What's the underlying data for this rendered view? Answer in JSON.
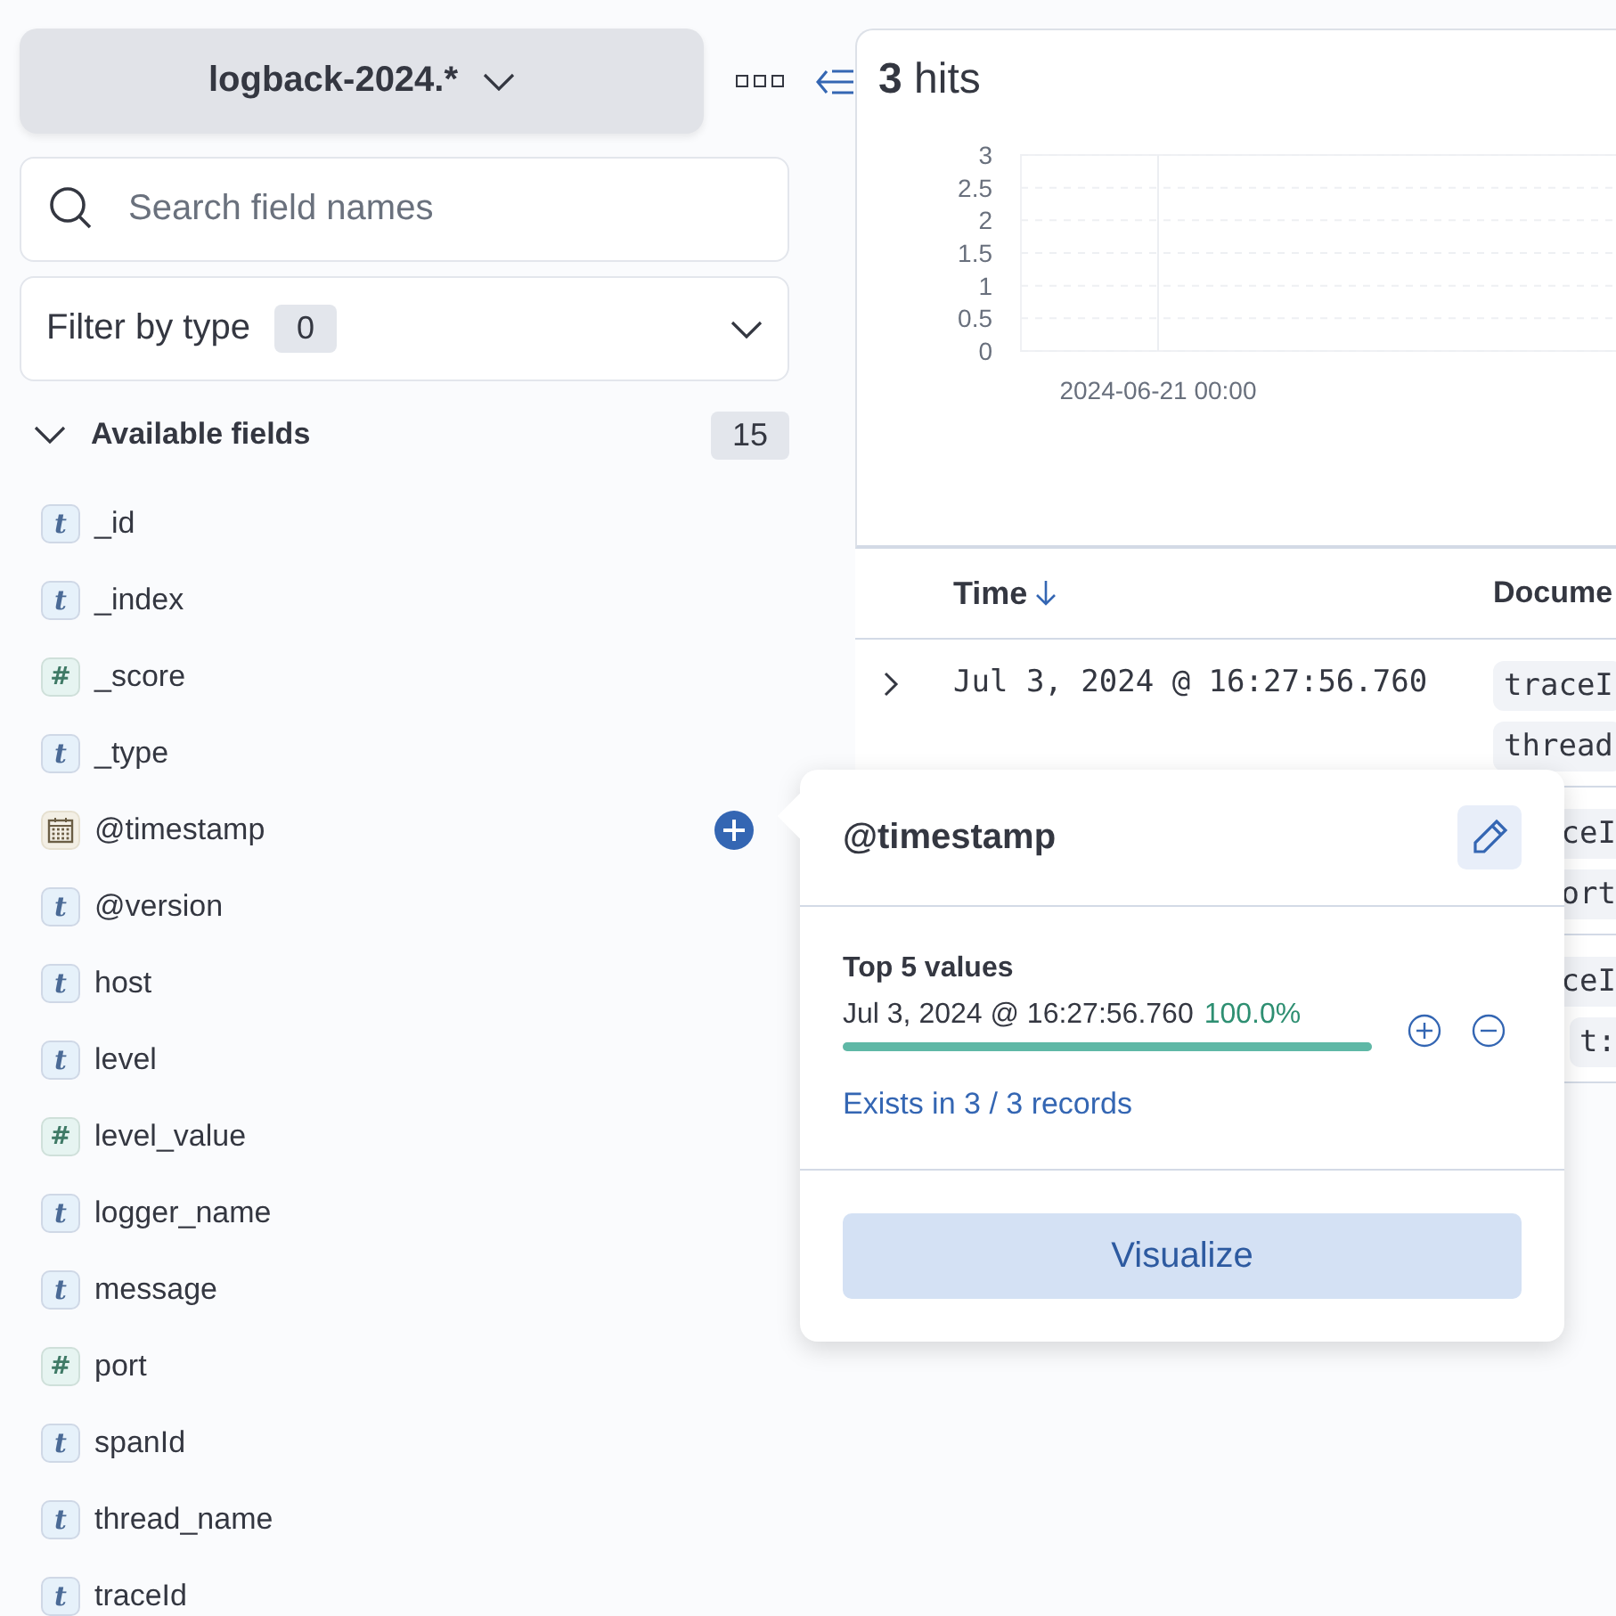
{
  "data_view": {
    "label": "logback-2024.*"
  },
  "search": {
    "placeholder": "Search field names"
  },
  "filter": {
    "label": "Filter by type",
    "count": "0"
  },
  "available_fields": {
    "label": "Available fields",
    "count": "15",
    "expanded": true,
    "items": [
      {
        "name": "_id",
        "kind": "text",
        "type_icon": "t",
        "selected": false
      },
      {
        "name": "_index",
        "kind": "text",
        "type_icon": "t",
        "selected": false
      },
      {
        "name": "_score",
        "kind": "number",
        "type_icon": "#",
        "selected": false
      },
      {
        "name": "_type",
        "kind": "text",
        "type_icon": "t",
        "selected": false
      },
      {
        "name": "@timestamp",
        "kind": "date",
        "selected": true
      },
      {
        "name": "@version",
        "kind": "text",
        "type_icon": "t",
        "selected": false
      },
      {
        "name": "host",
        "kind": "text",
        "type_icon": "t",
        "selected": false
      },
      {
        "name": "level",
        "kind": "text",
        "type_icon": "t",
        "selected": false
      },
      {
        "name": "level_value",
        "kind": "number",
        "type_icon": "#",
        "selected": false
      },
      {
        "name": "logger_name",
        "kind": "text",
        "type_icon": "t",
        "selected": false
      },
      {
        "name": "message",
        "kind": "text",
        "type_icon": "t",
        "selected": false
      },
      {
        "name": "port",
        "kind": "number",
        "type_icon": "#",
        "selected": false
      },
      {
        "name": "spanId",
        "kind": "text",
        "type_icon": "t",
        "selected": false
      },
      {
        "name": "thread_name",
        "kind": "text",
        "type_icon": "t",
        "selected": false
      },
      {
        "name": "traceId",
        "kind": "text",
        "type_icon": "t",
        "selected": false
      }
    ]
  },
  "hits": {
    "title": "**3** hits"
  },
  "histogram": {
    "y_axis_labels": [
      "3",
      "2.5",
      "2",
      "1.5",
      "1",
      "0.5",
      "0"
    ],
    "x_axis_labels": [
      "2024-06-21 00:00"
    ]
  },
  "table": {
    "columns": [
      {
        "label": "Time",
        "sorted": true
      },
      {
        "label": "Docume",
        "sorted": false
      }
    ],
    "rows": [
      {
        "time": "Jul 3, 2024 @ 16:27:56.760",
        "tokens": [
          "traceI",
          "thread"
        ]
      },
      {
        "time": "",
        "tokens": [
          "ceI",
          "ort"
        ]
      },
      {
        "time": "",
        "tokens": [
          "ceI",
          "t:"
        ]
      }
    ]
  },
  "popover": {
    "title": "@timestamp",
    "section": "Top 5 values",
    "values": [
      {
        "value": "Jul 3, 2024 @ 16:27:56.760",
        "percent": "100.0%",
        "level": 1.0
      }
    ],
    "exists": "Exists in 3 / 3 records",
    "button": "Visualize"
  }
}
